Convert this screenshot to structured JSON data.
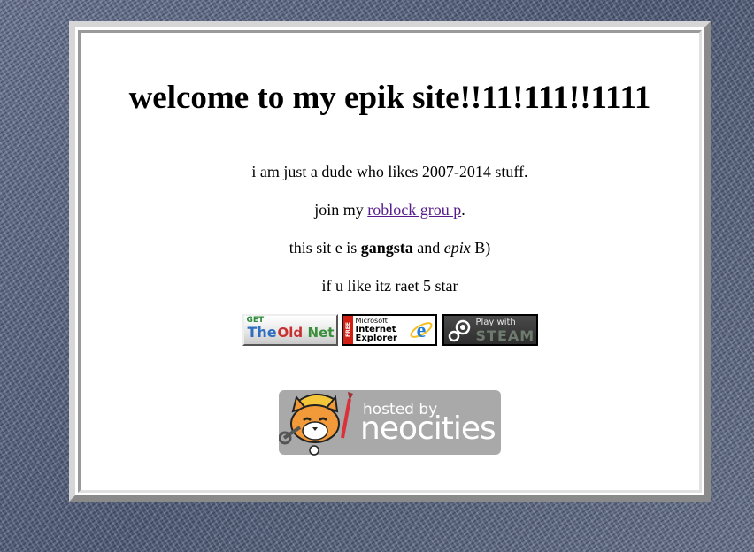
{
  "page": {
    "heading": "welcome to my epik site!!11!111!!1111",
    "line1": "i am just a dude who likes 2007-2014 stuff.",
    "line2_prefix": "join my ",
    "line2_link": "roblock grou p",
    "line2_suffix": ".",
    "line3_prefix": "this sit e is ",
    "line3_bold": "gangsta",
    "line3_mid": " and ",
    "line3_italic": "epix",
    "line3_suffix": " B)",
    "line4": "if u like itz raet 5 star"
  },
  "badges": {
    "oldnet": {
      "get": "GET",
      "the": "The",
      "old": "Old",
      "net": "Net"
    },
    "ie": {
      "free": "FREE",
      "microsoft": "Microsoft",
      "internet": "Internet",
      "explorer": "Explorer",
      "icon": "ie-logo-icon"
    },
    "steam": {
      "play_with": "Play with",
      "steam": "STEAM",
      "icon": "steam-logo-icon"
    }
  },
  "neocities": {
    "hosted_by": "hosted by",
    "name": "neocities",
    "icon": "neocities-cat-icon"
  },
  "colors": {
    "background": "#5d6780",
    "panel": "#ffffff",
    "link": "#551a8b"
  }
}
